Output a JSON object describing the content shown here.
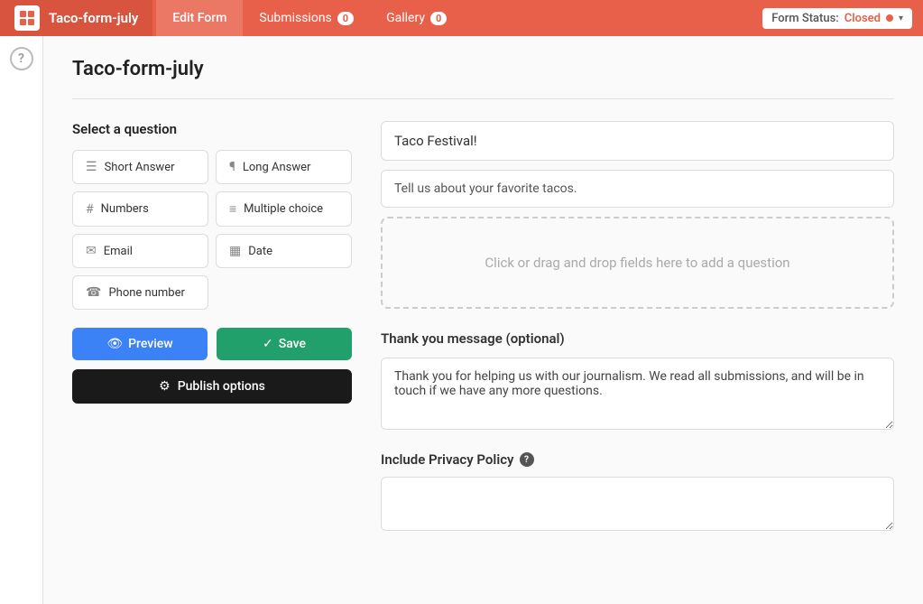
{
  "nav": {
    "brand_title": "Taco-form-july",
    "tabs": [
      {
        "id": "edit-form",
        "label": "Edit Form",
        "active": true,
        "badge": null
      },
      {
        "id": "submissions",
        "label": "Submissions",
        "active": false,
        "badge": "0"
      },
      {
        "id": "gallery",
        "label": "Gallery",
        "active": false,
        "badge": "0"
      }
    ],
    "form_status_label": "Form Status:",
    "form_status_value": "Closed"
  },
  "page": {
    "title": "Taco-form-july"
  },
  "left_panel": {
    "select_question_label": "Select a question",
    "question_types": [
      {
        "id": "short-answer",
        "label": "Short Answer",
        "icon": "☰"
      },
      {
        "id": "long-answer",
        "label": "Long Answer",
        "icon": "¶"
      },
      {
        "id": "numbers",
        "label": "Numbers",
        "icon": "#"
      },
      {
        "id": "multiple-choice",
        "label": "Multiple choice",
        "icon": "≡"
      },
      {
        "id": "email",
        "label": "Email",
        "icon": "✉"
      },
      {
        "id": "date",
        "label": "Date",
        "icon": "📅"
      },
      {
        "id": "phone-number",
        "label": "Phone number",
        "icon": "☎"
      }
    ],
    "preview_label": "Preview",
    "save_label": "Save",
    "publish_options_label": "Publish options"
  },
  "right_panel": {
    "form_title": "Taco Festival!",
    "form_subtitle": "Tell us about your favorite tacos.",
    "drop_zone_text": "Click or drag and drop fields here to add a question",
    "thank_you_label": "Thank you message (optional)",
    "thank_you_text": "Thank you for helping us with our journalism. We read all submissions, and will be in touch if we have any more questions.",
    "privacy_label": "Include Privacy Policy",
    "privacy_text": ""
  }
}
